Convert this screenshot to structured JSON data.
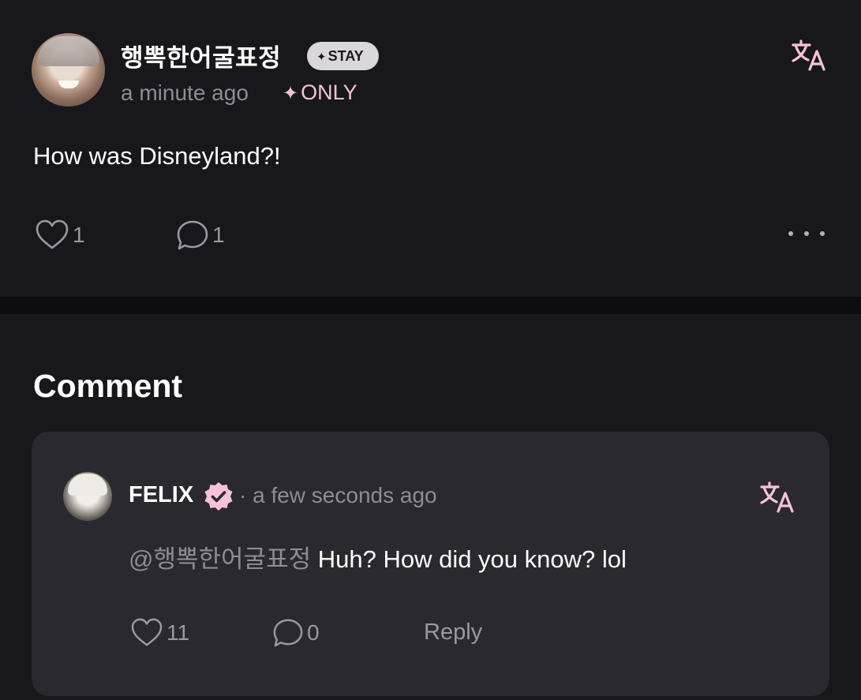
{
  "post": {
    "username": "행뽁한어굴표정",
    "badge": "STAY",
    "timestamp": "a minute ago",
    "visibility": "ONLY",
    "text": "How was Disneyland?!",
    "like_count": "1",
    "comment_count": "1"
  },
  "comments_section": {
    "title": "Comment"
  },
  "comment": {
    "username": "FELIX",
    "timestamp": "· a few seconds ago",
    "mention": "@행뽁한어굴표정",
    "text": " Huh? How did you know? lol",
    "like_count": "11",
    "reply_count": "0",
    "reply_label": "Reply"
  },
  "colors": {
    "background": "#18171c",
    "card": "#2a2930",
    "accent_pink": "#f5c2d8",
    "muted_text": "#8e8c94"
  },
  "icons": {
    "translate": "translate-icon",
    "heart": "heart-icon",
    "comment": "comment-bubble-icon",
    "more": "more-dots-icon",
    "verified": "verified-badge-icon"
  }
}
